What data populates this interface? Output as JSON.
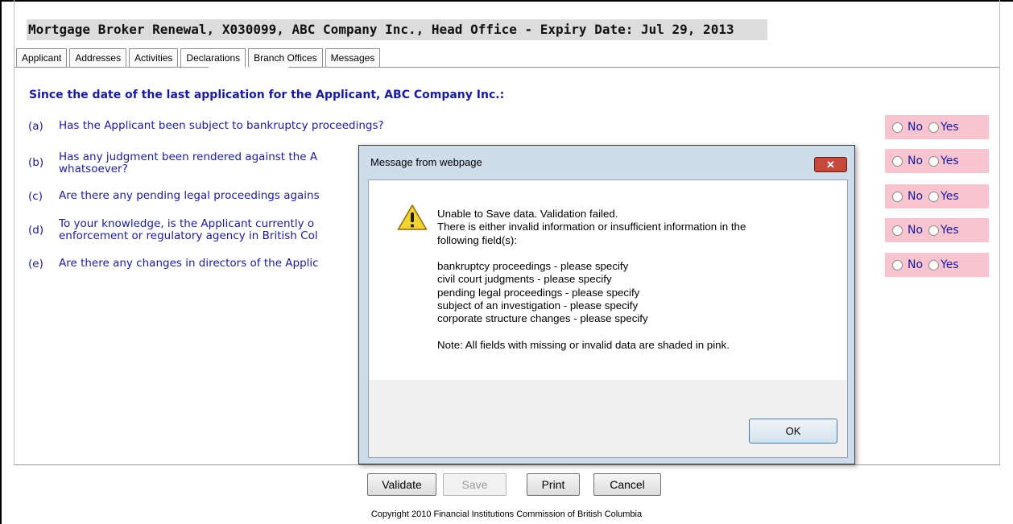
{
  "header": {
    "title": "Mortgage Broker Renewal, X030099, ABC Company Inc., Head Office - Expiry Date: Jul 29, 2013"
  },
  "tabs": [
    {
      "label": "Applicant"
    },
    {
      "label": "Addresses"
    },
    {
      "label": "Activities"
    },
    {
      "label": "Declarations",
      "active": true
    },
    {
      "label": "Branch Offices"
    },
    {
      "label": "Messages"
    }
  ],
  "declarations": {
    "heading": "Since the date of the last application for the Applicant, ABC Company Inc.:",
    "questions": [
      {
        "letter": "(a)",
        "lines": [
          "Has the Applicant been subject to bankruptcy proceedings?"
        ]
      },
      {
        "letter": "(b)",
        "lines": [
          "Has any judgment been rendered against the A",
          "whatsoever?"
        ]
      },
      {
        "letter": "(c)",
        "lines": [
          "Are there any pending legal proceedings agains"
        ]
      },
      {
        "letter": "(d)",
        "lines": [
          "To your knowledge, is the Applicant currently o",
          "enforcement or regulatory agency in British Col"
        ]
      },
      {
        "letter": "(e)",
        "lines": [
          "Are there any changes in directors of the Applic"
        ]
      }
    ],
    "radio_no_label": "No",
    "radio_yes_label": "Yes",
    "invalid_color": "#f7c4cf"
  },
  "dialog": {
    "title": "Message from webpage",
    "icon": "warning-icon",
    "message_lines": [
      "Unable to Save data. Validation failed.",
      "There is either invalid information or insufficient information in the",
      "following field(s):",
      "",
      "bankruptcy proceedings - please specify",
      "civil court judgments - please specify",
      "pending legal proceedings - please specify",
      "subject of an investigation - please specify",
      "corporate structure changes - please specify",
      "",
      "Note: All fields with missing or invalid data are shaded in pink."
    ],
    "ok_label": "OK"
  },
  "actions": {
    "validate_label": "Validate",
    "save_label": "Save",
    "print_label": "Print",
    "cancel_label": "Cancel"
  },
  "footer": {
    "copyright": "Copyright 2010 Financial Institutions Commission of British Columbia"
  }
}
